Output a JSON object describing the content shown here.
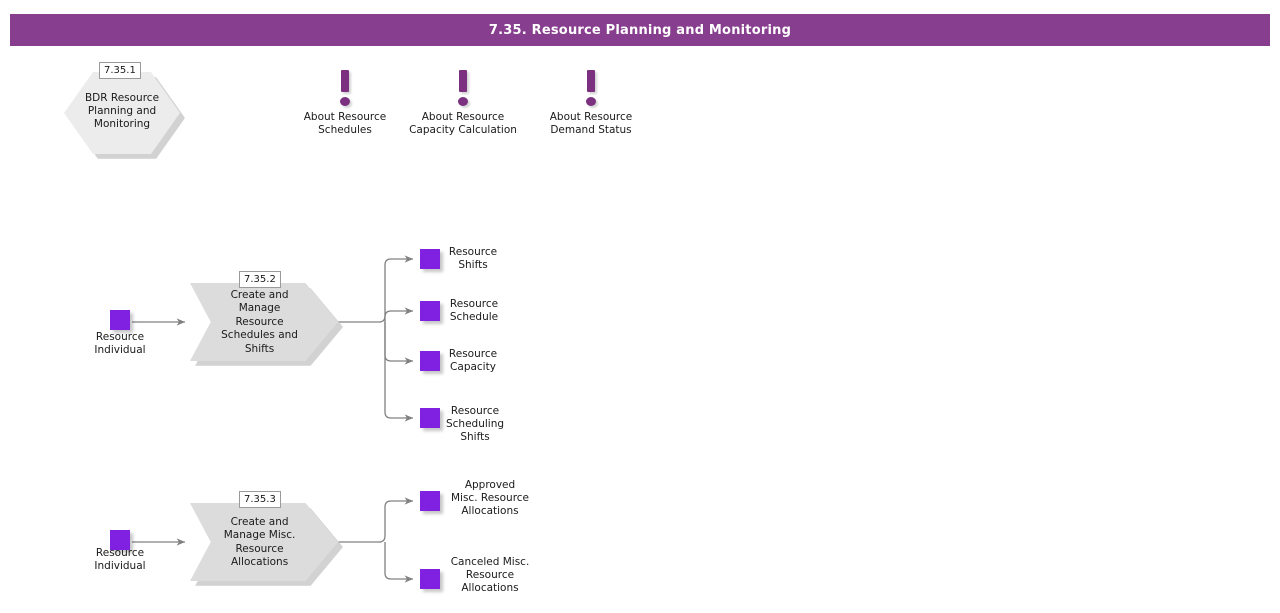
{
  "header": {
    "title": "7.35. Resource Planning and Monitoring",
    "accent_color": "#883e8e"
  },
  "palette": {
    "data_object": "#8020e0",
    "process_fill": "#dcdcdc",
    "hexagon_fill": "#ececec",
    "connector": "#808080",
    "info_icon": "#7b3080"
  },
  "overview_node": {
    "badge": "7.35.1",
    "label": "BDR Resource\nPlanning and\nMonitoring"
  },
  "info_items": [
    {
      "label": "About Resource\nSchedules",
      "icon": "exclamation-icon"
    },
    {
      "label": "About Resource\nCapacity Calculation",
      "icon": "exclamation-icon"
    },
    {
      "label": "About Resource\nDemand Status",
      "icon": "exclamation-icon"
    }
  ],
  "flows": [
    {
      "badge": "7.35.2",
      "process_label": "Create and\nManage\nResource\nSchedules and\nShifts",
      "input": {
        "label": "Resource\nIndividual"
      },
      "outputs": [
        {
          "label": "Resource\nShifts"
        },
        {
          "label": "Resource\nSchedule"
        },
        {
          "label": "Resource\nCapacity"
        },
        {
          "label": "Resource\nScheduling\nShifts"
        }
      ]
    },
    {
      "badge": "7.35.3",
      "process_label": "Create and\nManage Misc.\nResource\nAllocations",
      "input": {
        "label": "Resource\nIndividual"
      },
      "outputs": [
        {
          "label": "Approved\nMisc. Resource\nAllocations"
        },
        {
          "label": "Canceled Misc.\nResource\nAllocations"
        }
      ]
    }
  ]
}
